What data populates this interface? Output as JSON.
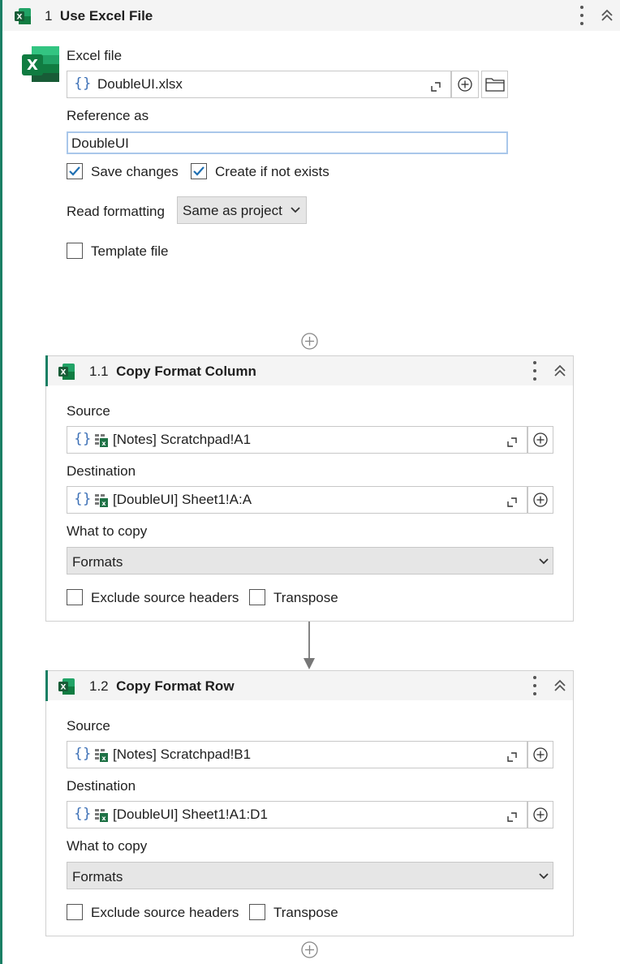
{
  "main_step": {
    "number": "1",
    "title": "Use Excel File",
    "excel_file_label": "Excel file",
    "excel_file_value": "DoubleUI.xlsx",
    "reference_label": "Reference as",
    "reference_value": "DoubleUI",
    "save_changes_label": "Save changes",
    "save_changes_checked": true,
    "create_if_not_exists_label": "Create if not exists",
    "create_if_not_exists_checked": true,
    "read_formatting_label": "Read formatting",
    "read_formatting_value": "Same as project",
    "template_file_label": "Template file",
    "template_file_checked": false
  },
  "steps": [
    {
      "number": "1.1",
      "title": "Copy Format Column",
      "source_label": "Source",
      "source_value": "[Notes] Scratchpad!A1",
      "destination_label": "Destination",
      "destination_value": "[DoubleUI] Sheet1!A:A",
      "what_to_copy_label": "What to copy",
      "what_to_copy_value": "Formats",
      "exclude_headers_label": "Exclude source headers",
      "transpose_label": "Transpose"
    },
    {
      "number": "1.2",
      "title": "Copy Format Row",
      "source_label": "Source",
      "source_value": "[Notes] Scratchpad!B1",
      "destination_label": "Destination",
      "destination_value": "[DoubleUI] Sheet1!A1:D1",
      "what_to_copy_label": "What to copy",
      "what_to_copy_value": "Formats",
      "exclude_headers_label": "Exclude source headers",
      "transpose_label": "Transpose"
    }
  ],
  "icons": {
    "excel": "excel-icon",
    "add": "add-circle-icon",
    "expand": "expand-icon",
    "folder": "folder-icon",
    "more": "more-vertical-icon",
    "collapse": "chevron-double-up-icon",
    "sheet": "sheet-range-icon",
    "checkmark": "checkmark-icon",
    "dropdown": "chevron-down-icon",
    "arrow": "arrow-down-icon"
  },
  "colors": {
    "accent": "#1a7f64",
    "excel_green": "#1e7145",
    "link_blue": "#3b6fb6",
    "check_blue": "#1f6fb2"
  }
}
